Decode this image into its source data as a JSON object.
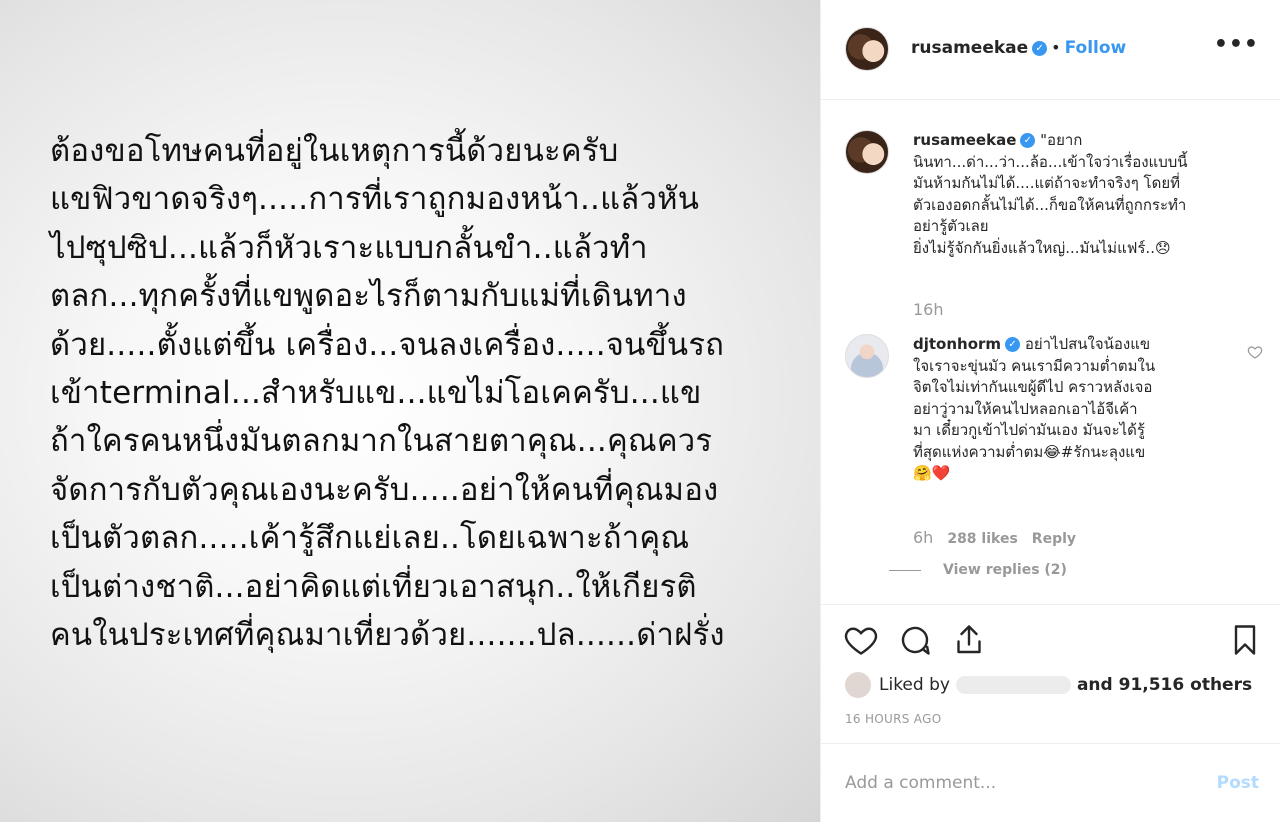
{
  "post_image": {
    "lines": [
      " ต้องขอโทษคนที่อยู่ในเหตุการนี้ด้วยนะครับ",
      "แขฟิวขาดจริงๆ.....การที่เราถูกมองหน้า..แล้วหัน",
      "ไปซุปซิป...แล้วก็หัวเราะแบบกลั้นขำ..แล้วทำ",
      "ตลก...ทุกครั้งที่แขพูดอะไรก็ตามกับแม่ที่เดินทาง",
      "ด้วย.....ตั้งแต่ขึ้น เครื่อง...จนลงเครื่อง.....จนขึ้นรถ",
      "เข้าterminal...สำหรับแข...แขไม่โอเคครับ...แข",
      "ถ้าใครคนหนึ่งมันตลกมากในสายตาคุณ...คุณควร",
      "จัดการกับตัวคุณเองนะครับ.....อย่าให้คนที่คุณมอง",
      "เป็นตัวตลก.....เค้ารู้สึกแย่เลย..โดยเฉพาะถ้าคุณ",
      "เป็นต่างชาติ...อย่าคิดแต่เที่ยวเอาสนุก..ให้เกียรติ",
      "คนในประเทศที่คุณมาเที่ยวด้วย.......ปล......ด่าฝรั่ง"
    ]
  },
  "header": {
    "username": "rusameekae",
    "separator": "•",
    "follow_label": "Follow",
    "more_label": "•••"
  },
  "caption": {
    "username": "rusameekae",
    "lines": [
      "\"อยาก",
      "นินทา...ด่า...ว่า...ล้อ...เข้าใจว่าเรื่องแบบนี้",
      "มันห้ามกันไม่ได้....แต่ถ้าจะทำจริงๆ โดยที่",
      "ตัวเองอดกลั้นไม่ได้...ก็ขอให้คนที่ถูกกระทำ",
      "อย่ารู้ตัวเลย",
      "ยิ่งไม่รู้จักกันยิ่งแล้วใหญ่...มันไม่แฟร์..😞"
    ],
    "time": "16h"
  },
  "reply": {
    "username": "djtonhorm",
    "lines": [
      "อย่าไปสนใจน้องแข",
      "ใจเราจะขุ่นมัว คนเรามีความต่ำตมใน",
      "จิตใจไม่เท่ากันแขผู้ดีไป คราวหลังเจอ",
      "อย่าวู่วามให้คนไปหลอกเอาไอ้จีเค้า",
      "มา เดี๋ยวกูเข้าไปด่ามันเอง มันจะได้รู้",
      "ที่สุดแห่งความต่ำตม😂#รักนะลุงแข",
      "🤗❤️"
    ],
    "time": "6h",
    "likes": "288 likes",
    "reply_label": "Reply",
    "view_replies": "View replies (2)"
  },
  "engagement": {
    "liked_by_prefix": "Liked by",
    "liked_by_suffix": "and 91,516 others",
    "timestamp": "16 HOURS AGO"
  },
  "add_comment": {
    "placeholder": "Add a comment...",
    "post_label": "Post"
  },
  "colors": {
    "accent": "#3897f0",
    "muted": "#999999",
    "border": "#efefef"
  }
}
